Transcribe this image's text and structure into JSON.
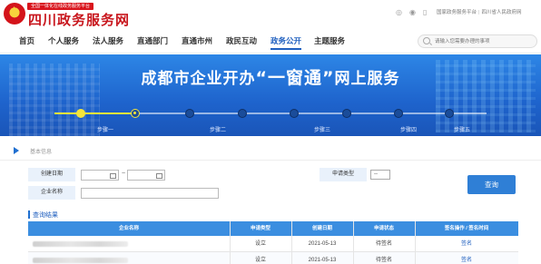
{
  "header": {
    "slogan": "全国一体化在线政务服务平台",
    "site_title": "四川政务服务网",
    "icons": [
      "wechat-icon",
      "weibo-icon",
      "mobile-icon"
    ],
    "top_links": [
      "国家政务服务平台",
      "四川省人民政府网"
    ]
  },
  "nav": {
    "items": [
      "首页",
      "个人服务",
      "法人服务",
      "直通部门",
      "直通市州",
      "政民互动",
      "政务公开",
      "主题服务"
    ],
    "active": "政务公开",
    "search_placeholder": "请输入您需要办理的事项"
  },
  "banner": {
    "title_prefix": "成都市企业开办",
    "title_highlight": "“一窗通”",
    "title_suffix": "网上服务",
    "steps": [
      "步骤一",
      "步骤二",
      "步骤三",
      "步骤四",
      "步骤五"
    ],
    "current_step": 1
  },
  "breadcrumb": {
    "text": "基本信息"
  },
  "form": {
    "created_date_label": "创建日期",
    "date_separator": "~",
    "apply_type_label": "申请类型",
    "apply_type_value": "--",
    "company_name_label": "企业名称",
    "query_button": "查询"
  },
  "results": {
    "title": "查询结果",
    "columns": [
      "企业名称",
      "申请类型",
      "创建日期",
      "申请状态",
      "签名操作 / 签名时间"
    ],
    "rows": [
      {
        "name": "",
        "type": "设立",
        "date": "2021-05-13",
        "status": "待签名",
        "action": "签名"
      },
      {
        "name": "",
        "type": "设立",
        "date": "2021-05-13",
        "status": "待签名",
        "action": "签名"
      }
    ]
  },
  "colors": {
    "brand_red": "#c8161d",
    "primary_blue": "#1f5fbf",
    "table_header": "#3b8ee0",
    "step_done": "#f5e43a"
  }
}
